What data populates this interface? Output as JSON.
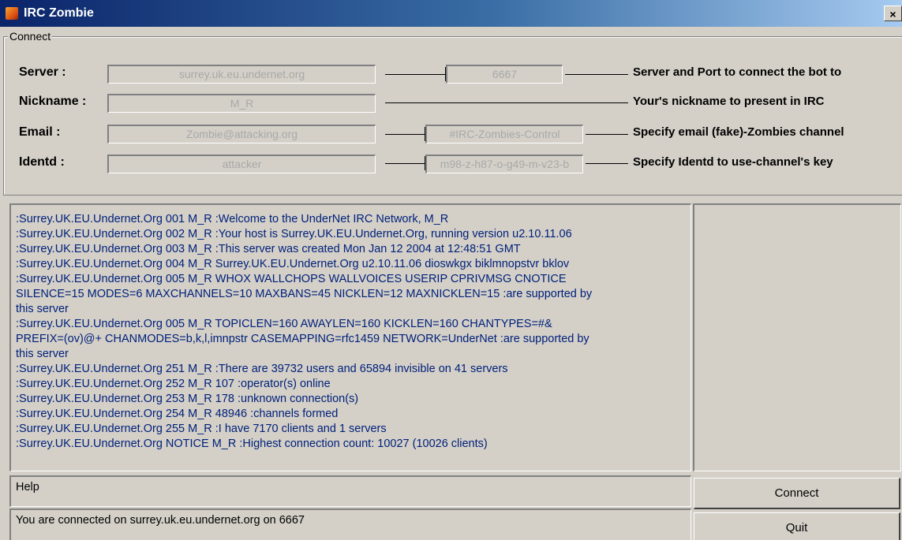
{
  "window": {
    "title": "IRC Zombie",
    "close_glyph": "×",
    "icon": "irc-zombie-app-icon"
  },
  "connect_group": {
    "legend": "Connect",
    "server": {
      "label": "Server :",
      "host_value": "surrey.uk.eu.undernet.org",
      "port_value": "6667",
      "description": "Server and Port to connect the bot to"
    },
    "nickname": {
      "label": "Nickname :",
      "value": "M_R",
      "description": "Your's nickname to present in IRC"
    },
    "email": {
      "label": "Email :",
      "value": "Zombie@attacking.org",
      "channel_value": "#IRC-Zombies-Control",
      "description": "Specify email (fake)-Zombies channel"
    },
    "identd": {
      "label": "Identd :",
      "value": "attacker",
      "key_value": "m98-z-h87-o-g49-m-v23-b",
      "description": "Specify Identd to use-channel's key"
    }
  },
  "log": {
    "lines": [
      ":Surrey.UK.EU.Undernet.Org 001 M_R :Welcome to the UnderNet IRC Network, M_R",
      ":Surrey.UK.EU.Undernet.Org 002 M_R :Your host is Surrey.UK.EU.Undernet.Org, running version u2.10.11.06",
      ":Surrey.UK.EU.Undernet.Org 003 M_R :This server was created Mon Jan 12 2004 at 12:48:51 GMT",
      ":Surrey.UK.EU.Undernet.Org 004 M_R Surrey.UK.EU.Undernet.Org u2.10.11.06 dioswkgx biklmnopstvr bklov",
      ":Surrey.UK.EU.Undernet.Org 005 M_R WHOX WALLCHOPS WALLVOICES USERIP CPRIVMSG CNOTICE",
      "SILENCE=15 MODES=6 MAXCHANNELS=10 MAXBANS=45 NICKLEN=12 MAXNICKLEN=15 :are supported by",
      "this server",
      ":Surrey.UK.EU.Undernet.Org 005 M_R TOPICLEN=160 AWAYLEN=160 KICKLEN=160 CHANTYPES=#&",
      "PREFIX=(ov)@+ CHANMODES=b,k,l,imnpstr CASEMAPPING=rfc1459 NETWORK=UnderNet :are supported by",
      "this server",
      ":Surrey.UK.EU.Undernet.Org 251 M_R :There are 39732 users and 65894 invisible on 41 servers",
      ":Surrey.UK.EU.Undernet.Org 252 M_R 107 :operator(s) online",
      ":Surrey.UK.EU.Undernet.Org 253 M_R 178 :unknown connection(s)",
      ":Surrey.UK.EU.Undernet.Org 254 M_R 48946 :channels formed",
      ":Surrey.UK.EU.Undernet.Org 255 M_R :I have 7170 clients and 1 servers",
      ":Surrey.UK.EU.Undernet.Org NOTICE M_R :Highest connection count: 10027 (10026 clients)"
    ]
  },
  "help_text": "Help",
  "status_text": "You are connected on surrey.uk.eu.undernet.org on 6667",
  "buttons": {
    "connect": "Connect",
    "quit": "Quit"
  }
}
